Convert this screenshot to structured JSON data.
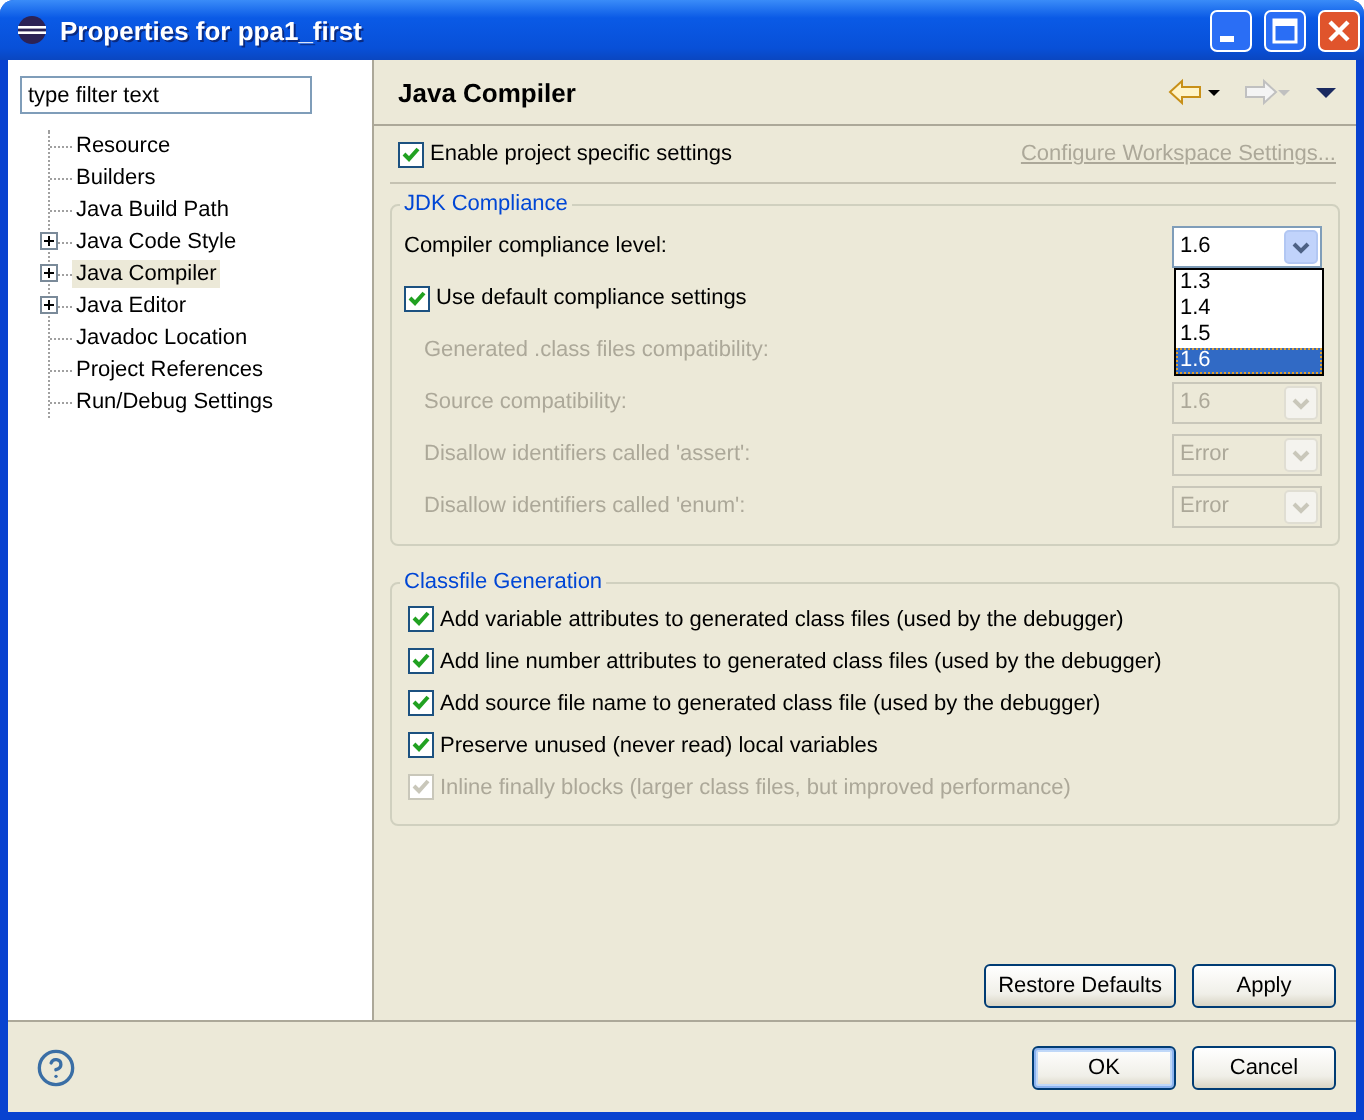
{
  "window": {
    "title": "Properties for ppa1_first"
  },
  "filter": {
    "placeholder": "type filter text"
  },
  "tree": [
    {
      "label": "Resource",
      "kind": "leaf",
      "selected": false
    },
    {
      "label": "Builders",
      "kind": "leaf",
      "selected": false
    },
    {
      "label": "Java Build Path",
      "kind": "leaf",
      "selected": false
    },
    {
      "label": "Java Code Style",
      "kind": "expander",
      "selected": false
    },
    {
      "label": "Java Compiler",
      "kind": "expander",
      "selected": true
    },
    {
      "label": "Java Editor",
      "kind": "expander",
      "selected": false
    },
    {
      "label": "Javadoc Location",
      "kind": "leaf",
      "selected": false
    },
    {
      "label": "Project References",
      "kind": "leaf",
      "selected": false
    },
    {
      "label": "Run/Debug Settings",
      "kind": "leaf",
      "selected": false
    }
  ],
  "page": {
    "title": "Java Compiler",
    "enable": {
      "label": "Enable project specific settings",
      "checked": true
    },
    "configure_link": "Configure Workspace Settings...",
    "jdk": {
      "title": "JDK Compliance",
      "compliance": {
        "label": "Compiler compliance level:",
        "value": "1.6",
        "expanded": true,
        "options": [
          {
            "label": "1.3",
            "selected": false
          },
          {
            "label": "1.4",
            "selected": false
          },
          {
            "label": "1.5",
            "selected": false
          },
          {
            "label": "1.6",
            "selected": true
          }
        ]
      },
      "use_default": {
        "label": "Use default compliance settings",
        "checked": true
      },
      "settings": [
        {
          "label": "Generated .class files compatibility:",
          "disabled": true
        },
        {
          "label": "Source compatibility:",
          "value": "1.6",
          "disabled": true
        },
        {
          "label": "Disallow identifiers called 'assert':",
          "value": "Error",
          "disabled": true
        },
        {
          "label": "Disallow identifiers called 'enum':",
          "value": "Error",
          "disabled": true
        }
      ]
    },
    "classfile": {
      "title": "Classfile Generation",
      "options": [
        {
          "label": "Add variable attributes to generated class files (used by the debugger)",
          "checked": true,
          "disabled": false
        },
        {
          "label": "Add line number attributes to generated class files (used by the debugger)",
          "checked": true,
          "disabled": false
        },
        {
          "label": "Add source file name to generated class file (used by the debugger)",
          "checked": true,
          "disabled": false
        },
        {
          "label": "Preserve unused (never read) local variables",
          "checked": true,
          "disabled": false
        },
        {
          "label": "Inline finally blocks (larger class files, but improved performance)",
          "checked": true,
          "disabled": true
        }
      ]
    },
    "buttons": [
      {
        "label": "Restore Defaults"
      },
      {
        "label": "Apply"
      }
    ]
  },
  "dialog_buttons": [
    {
      "label": "OK",
      "default": true
    },
    {
      "label": "Cancel",
      "default": false
    }
  ]
}
